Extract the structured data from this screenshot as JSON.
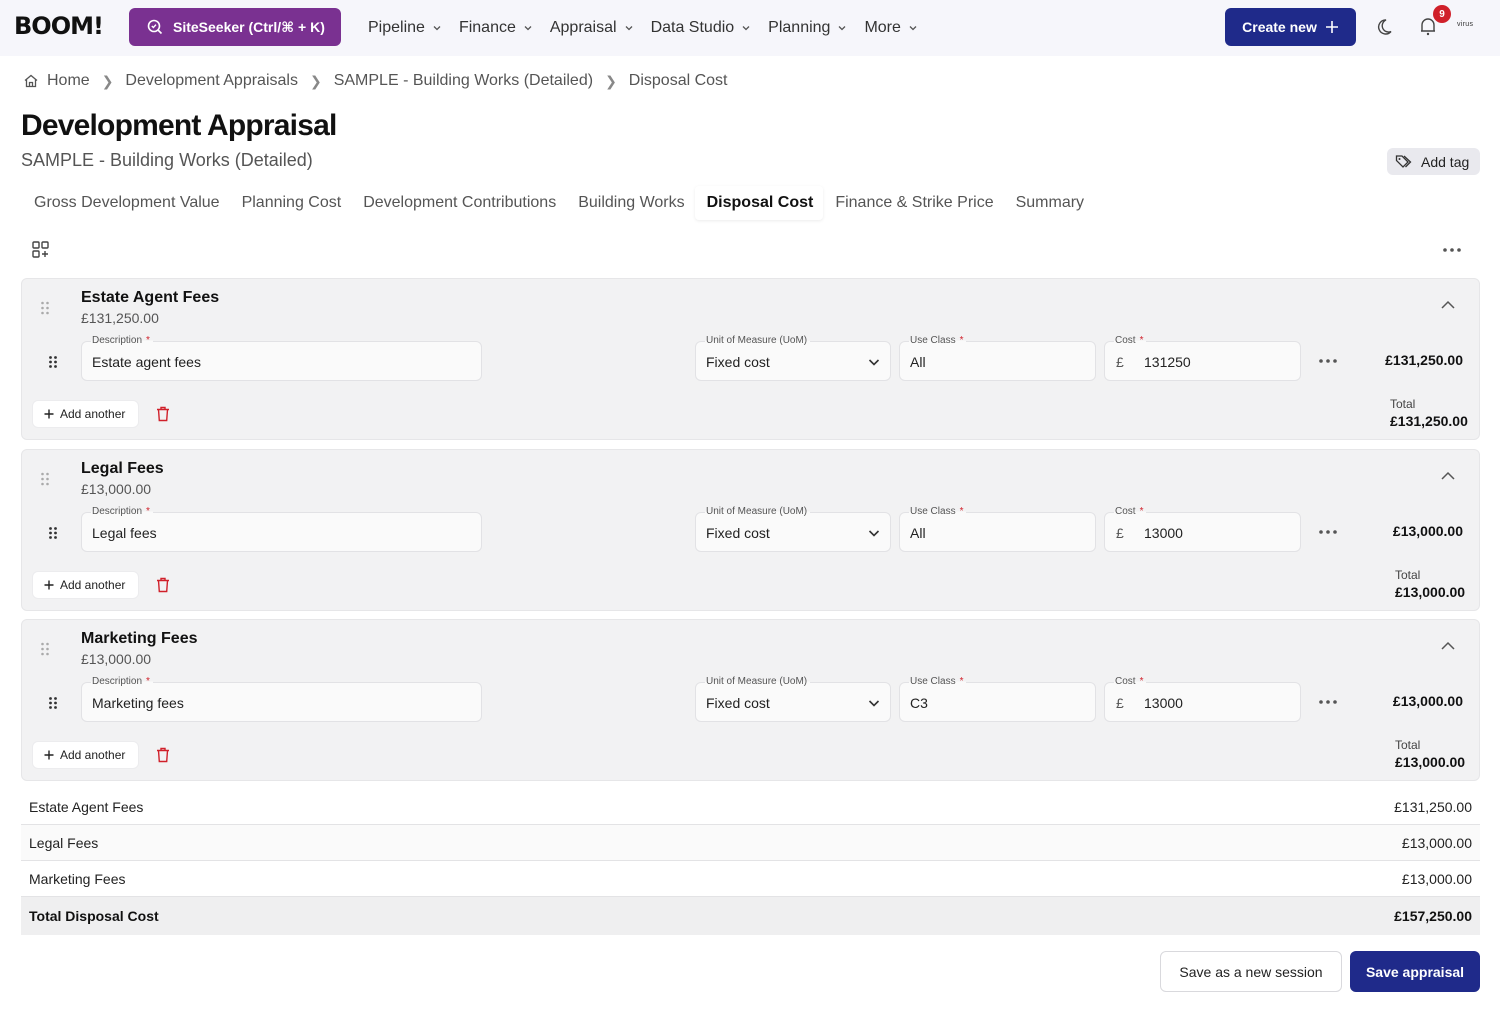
{
  "topnav": {
    "logo": "BOOM!",
    "siteseeker_label": "SiteSeeker (Ctrl/⌘ + K)",
    "menu": [
      {
        "label": "Pipeline"
      },
      {
        "label": "Finance"
      },
      {
        "label": "Appraisal"
      },
      {
        "label": "Data Studio"
      },
      {
        "label": "Planning"
      },
      {
        "label": "More"
      }
    ],
    "create_label": "Create new",
    "notification_count": "9",
    "user_label": "virus",
    "brand_color": "#7a3191",
    "primary_color": "#1f2a8a"
  },
  "breadcrumb": [
    {
      "label": "Home"
    },
    {
      "label": "Development Appraisals"
    },
    {
      "label": "SAMPLE - Building Works (Detailed)"
    },
    {
      "label": "Disposal Cost"
    }
  ],
  "page": {
    "title": "Development Appraisal",
    "subtitle": "SAMPLE - Building Works (Detailed)",
    "add_tag_label": "Add tag"
  },
  "tabs": [
    {
      "label": "Gross Development Value",
      "active": false
    },
    {
      "label": "Planning Cost",
      "active": false
    },
    {
      "label": "Development Contributions",
      "active": false
    },
    {
      "label": "Building Works",
      "active": false
    },
    {
      "label": "Disposal Cost",
      "active": true
    },
    {
      "label": "Finance & Strike Price",
      "active": false
    },
    {
      "label": "Summary",
      "active": false
    }
  ],
  "field_labels": {
    "description": "Description",
    "uom": "Unit of Measure (UoM)",
    "use_class": "Use Class",
    "cost": "Cost",
    "required_mark": "*",
    "currency_symbol": "£",
    "add_another": "Add another",
    "total": "Total"
  },
  "sections": [
    {
      "title": "Estate Agent Fees",
      "amount": "£131,250.00",
      "description": "Estate agent fees",
      "uom": "Fixed cost",
      "use_class": "All",
      "cost": "131250",
      "row_total": "£131,250.00",
      "total": "£131,250.00"
    },
    {
      "title": "Legal Fees",
      "amount": "£13,000.00",
      "description": "Legal fees",
      "uom": "Fixed cost",
      "use_class": "All",
      "cost": "13000",
      "row_total": "£13,000.00",
      "total": "£13,000.00"
    },
    {
      "title": "Marketing Fees",
      "amount": "£13,000.00",
      "description": "Marketing fees",
      "uom": "Fixed cost",
      "use_class": "C3",
      "cost": "13000",
      "row_total": "£13,000.00",
      "total": "£13,000.00"
    }
  ],
  "summary": {
    "rows": [
      {
        "label": "Estate Agent Fees",
        "value": "£131,250.00"
      },
      {
        "label": "Legal Fees",
        "value": "£13,000.00"
      },
      {
        "label": "Marketing Fees",
        "value": "£13,000.00"
      }
    ],
    "total_label": "Total Disposal Cost",
    "total_value": "£157,250.00"
  },
  "footer": {
    "save_session_label": "Save as a new session",
    "save_label": "Save appraisal"
  }
}
